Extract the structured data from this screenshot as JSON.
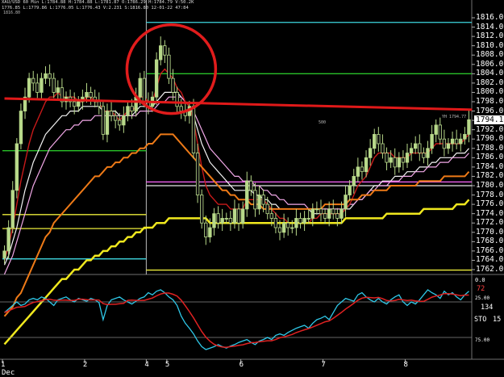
{
  "header": {
    "line1": "XAU/USD 60 Min L:1784.88 H:1784.88 L:1781.87 O:1786.29 H:1784.79 V:50.2K",
    "line2": "1776.85 L:1779.86 L:1776.05 L:1776.43 V:2.231 S:1816.80 12-01-22 47:84"
  },
  "labels": {
    "top_left_price": "1816.80",
    "current_price": "1794.14",
    "current_tag": "YH 1794.77",
    "mid_tag": "500",
    "stoch_upper_val": "72",
    "stoch_ref_high": "25.00",
    "stoch_ref_low": "75.00",
    "stoch_name": "STO",
    "stoch_k": "15",
    "stoch_d": "134",
    "stoch_cut": "0.0"
  },
  "colors": {
    "background": "#000000",
    "candle_up": "#b8d98a",
    "candle_down": "#111111",
    "wick": "#b8d98a",
    "hline_green": "#29c229",
    "hline_yellow": "#ecec3a",
    "hline_cyan": "#3ed8e0",
    "hline_pink": "#ff66ff",
    "hline_white": "#e6e6e6",
    "trendline_red": "#e01919",
    "ma_white": "#f4f4f4",
    "ma_pink": "#f2a8e8",
    "ma_darkred": "#c81a1a",
    "ma_orange": "#ee7a17",
    "ma_yellow": "#f0e81e",
    "stoch_k": "#2fc8e8",
    "stoch_d": "#e02222",
    "circle": "#e11c1c",
    "separator": "#707070"
  },
  "chart_data": {
    "type": "candlestick",
    "title": "",
    "ylim": [
      1760,
      1817
    ],
    "y_ticks": [
      "1816.00",
      "1814.00",
      "1812.00",
      "1810.00",
      "1808.00",
      "1806.00",
      "1804.00",
      "1802.00",
      "1800.00",
      "1798.00",
      "1796.00",
      "1794.00",
      "1792.00",
      "1790.00",
      "1788.00",
      "1786.00",
      "1784.00",
      "1782.00",
      "1780.00",
      "1778.00",
      "1776.00",
      "1774.00",
      "1772.00",
      "1770.00",
      "1768.00",
      "1766.00",
      "1764.00",
      "1762.00"
    ],
    "x_labels": [
      {
        "text": "1",
        "bar": 0
      },
      {
        "text": "2",
        "bar": 20
      },
      {
        "text": "4",
        "bar": 35
      },
      {
        "text": "5",
        "bar": 40
      },
      {
        "text": "6",
        "bar": 58
      },
      {
        "text": "7",
        "bar": 78
      },
      {
        "text": "8",
        "bar": 98
      }
    ],
    "x_sub_label": "Dec",
    "day_separator_bar": 35,
    "closes": [
      1766,
      1771,
      1779,
      1789,
      1796,
      1799,
      1803,
      1802,
      1800,
      1803,
      1804,
      1803,
      1800,
      1801,
      1798,
      1799,
      1798,
      1797,
      1798,
      1799,
      1800,
      1799,
      1798,
      1797,
      1791,
      1796,
      1795,
      1794,
      1793,
      1795,
      1797,
      1796,
      1799,
      1803,
      1798,
      1797,
      1799,
      1807,
      1810,
      1808,
      1803,
      1800,
      1797,
      1796,
      1795,
      1797,
      1787,
      1778,
      1772,
      1769,
      1771,
      1774,
      1772,
      1773,
      1773,
      1772,
      1775,
      1772,
      1775,
      1781,
      1779,
      1775,
      1778,
      1776,
      1774,
      1773,
      1771,
      1770,
      1772,
      1771,
      1771,
      1773,
      1772,
      1773,
      1773,
      1775,
      1775,
      1774,
      1773,
      1775,
      1774,
      1773,
      1775,
      1778,
      1780,
      1782,
      1784,
      1783,
      1786,
      1788,
      1791,
      1789,
      1787,
      1785,
      1786,
      1784,
      1786,
      1785,
      1787,
      1788,
      1789,
      1787,
      1786,
      1788,
      1791,
      1793,
      1790,
      1788,
      1789,
      1790,
      1789,
      1790,
      1791,
      1794.14
    ],
    "horizontal_levels": [
      {
        "price": 1815.0,
        "color": "cyan",
        "from_bar": 35
      },
      {
        "price": 1804.0,
        "color": "green",
        "from_bar": 35
      },
      {
        "price": 1787.5,
        "color": "green",
        "from_bar": 0,
        "to_bar": 35
      },
      {
        "price": 1780.8,
        "color": "pink",
        "from_bar": 35
      },
      {
        "price": 1780.0,
        "color": "white",
        "from_bar": 35
      },
      {
        "price": 1773.8,
        "color": "yellow",
        "from_bar": 0,
        "to_bar": 35
      },
      {
        "price": 1770.8,
        "color": "yellow",
        "from_bar": 0,
        "to_bar": 35
      },
      {
        "price": 1764.3,
        "color": "cyan",
        "from_bar": 0,
        "to_bar": 35
      },
      {
        "price": 1761.9,
        "color": "yellow",
        "from_bar": 35
      }
    ],
    "trendline": {
      "from_bar": 0,
      "from_price": 1798.7,
      "to_bar": 113,
      "to_price": 1796.3
    },
    "moving_averages": [
      {
        "color": "white",
        "values": [
          1763,
          1765,
          1768,
          1771,
          1775,
          1779,
          1782,
          1785,
          1787,
          1789,
          1791,
          1792,
          1793,
          1794,
          1795,
          1795,
          1796,
          1796,
          1796,
          1797,
          1797,
          1797,
          1797,
          1797,
          1796,
          1796,
          1796,
          1796,
          1795,
          1795,
          1795,
          1795,
          1796,
          1797,
          1797,
          1797,
          1797,
          1798,
          1799,
          1800,
          1800,
          1800,
          1800,
          1799,
          1798,
          1797,
          1795,
          1792,
          1789,
          1787,
          1785,
          1784,
          1783,
          1782,
          1781,
          1780,
          1779,
          1779,
          1779,
          1779,
          1779,
          1778,
          1778,
          1777,
          1777,
          1776,
          1776,
          1775,
          1775,
          1775,
          1775,
          1775,
          1775,
          1775,
          1775,
          1774,
          1774,
          1774,
          1774,
          1774,
          1774,
          1774,
          1774,
          1775,
          1775,
          1776,
          1777,
          1777,
          1778,
          1779,
          1780,
          1780,
          1781,
          1781,
          1781,
          1782,
          1782,
          1782,
          1783,
          1783,
          1783,
          1784,
          1784,
          1784,
          1785,
          1785,
          1786,
          1786,
          1786,
          1786,
          1787,
          1787,
          1787,
          1788
        ]
      },
      {
        "color": "pink",
        "values": [
          1761,
          1763,
          1765,
          1768,
          1771,
          1774,
          1777,
          1780,
          1782,
          1784,
          1786,
          1788,
          1789,
          1790,
          1791,
          1792,
          1792,
          1793,
          1793,
          1794,
          1794,
          1794,
          1795,
          1795,
          1795,
          1795,
          1795,
          1795,
          1795,
          1795,
          1795,
          1795,
          1795,
          1796,
          1796,
          1796,
          1796,
          1797,
          1798,
          1798,
          1799,
          1799,
          1799,
          1799,
          1798,
          1797,
          1796,
          1794,
          1792,
          1790,
          1788,
          1787,
          1786,
          1785,
          1784,
          1783,
          1782,
          1782,
          1781,
          1781,
          1781,
          1780,
          1780,
          1779,
          1779,
          1778,
          1778,
          1777,
          1777,
          1776,
          1776,
          1776,
          1776,
          1776,
          1775,
          1775,
          1775,
          1775,
          1775,
          1775,
          1775,
          1775,
          1775,
          1775,
          1776,
          1776,
          1777,
          1777,
          1778,
          1779,
          1779,
          1780,
          1780,
          1780,
          1781,
          1781,
          1781,
          1782,
          1782,
          1782,
          1783,
          1783,
          1783,
          1784,
          1784,
          1784,
          1785,
          1785,
          1785,
          1786,
          1786,
          1786,
          1786,
          1787
        ]
      },
      {
        "color": "darkred",
        "values": [
          1764,
          1767,
          1771,
          1776,
          1781,
          1785,
          1789,
          1792,
          1794,
          1796,
          1798,
          1799,
          1799,
          1800,
          1799,
          1799,
          1799,
          1799,
          1798,
          1798,
          1799,
          1799,
          1798,
          1798,
          1796,
          1796,
          1796,
          1795,
          1794,
          1795,
          1796,
          1796,
          1797,
          1799,
          1799,
          1798,
          1798,
          1801,
          1804,
          1805,
          1804,
          1803,
          1801,
          1800,
          1798,
          1797,
          1794,
          1789,
          1784,
          1780,
          1778,
          1777,
          1776,
          1776,
          1776,
          1775,
          1775,
          1775,
          1775,
          1777,
          1777,
          1777,
          1777,
          1777,
          1776,
          1775,
          1774,
          1773,
          1773,
          1772,
          1772,
          1772,
          1772,
          1772,
          1772,
          1773,
          1773,
          1774,
          1774,
          1774,
          1774,
          1774,
          1774,
          1775,
          1776,
          1778,
          1780,
          1781,
          1782,
          1784,
          1786,
          1787,
          1787,
          1787,
          1787,
          1786,
          1786,
          1786,
          1786,
          1787,
          1787,
          1787,
          1787,
          1787,
          1788,
          1789,
          1789,
          1789,
          1789,
          1789,
          1789,
          1789,
          1790,
          1791
        ]
      },
      {
        "color": "orange",
        "values": [
          1752,
          1753,
          1754,
          1756,
          1757,
          1759,
          1761,
          1763,
          1765,
          1767,
          1769,
          1770,
          1772,
          1773,
          1774,
          1775,
          1776,
          1777,
          1778,
          1779,
          1780,
          1781,
          1782,
          1782,
          1783,
          1784,
          1784,
          1785,
          1785,
          1786,
          1786,
          1787,
          1787,
          1788,
          1788,
          1789,
          1789,
          1790,
          1791,
          1791,
          1791,
          1791,
          1790,
          1789,
          1788,
          1787,
          1786,
          1785,
          1784,
          1783,
          1782,
          1781,
          1780,
          1779,
          1779,
          1778,
          1778,
          1777,
          1777,
          1777,
          1776,
          1776,
          1776,
          1775,
          1775,
          1775,
          1775,
          1775,
          1775,
          1775,
          1775,
          1775,
          1775,
          1775,
          1775,
          1775,
          1775,
          1775,
          1776,
          1776,
          1776,
          1776,
          1776,
          1776,
          1777,
          1777,
          1777,
          1778,
          1778,
          1778,
          1779,
          1779,
          1779,
          1779,
          1780,
          1780,
          1780,
          1780,
          1780,
          1780,
          1780,
          1781,
          1781,
          1781,
          1781,
          1781,
          1781,
          1782,
          1782,
          1782,
          1782,
          1782,
          1782,
          1783
        ]
      },
      {
        "color": "yellow",
        "values": [
          1746,
          1747,
          1748,
          1749,
          1750,
          1751,
          1752,
          1753,
          1754,
          1755,
          1756,
          1757,
          1758,
          1759,
          1760,
          1760,
          1761,
          1762,
          1762,
          1763,
          1764,
          1764,
          1765,
          1765,
          1766,
          1766,
          1767,
          1767,
          1768,
          1768,
          1769,
          1769,
          1770,
          1770,
          1771,
          1771,
          1771,
          1772,
          1772,
          1772,
          1773,
          1773,
          1773,
          1773,
          1773,
          1773,
          1773,
          1773,
          1773,
          1773,
          1772,
          1772,
          1772,
          1772,
          1772,
          1772,
          1772,
          1772,
          1772,
          1772,
          1772,
          1772,
          1772,
          1772,
          1772,
          1772,
          1772,
          1772,
          1772,
          1772,
          1772,
          1772,
          1772,
          1772,
          1772,
          1772,
          1772,
          1772,
          1772,
          1772,
          1772,
          1772,
          1772,
          1773,
          1773,
          1773,
          1773,
          1773,
          1773,
          1773,
          1773,
          1773,
          1773,
          1774,
          1774,
          1774,
          1774,
          1774,
          1774,
          1774,
          1774,
          1774,
          1775,
          1775,
          1775,
          1775,
          1775,
          1775,
          1775,
          1775,
          1776,
          1776,
          1776,
          1777
        ]
      }
    ],
    "highlight_circle": {
      "bar": 40,
      "price": 1805.5
    },
    "stochastic": {
      "ylim": [
        0,
        100
      ],
      "levels": [
        25,
        75
      ],
      "k": [
        40,
        35,
        30,
        25,
        30,
        28,
        22,
        20,
        22,
        18,
        20,
        25,
        30,
        22,
        20,
        18,
        22,
        25,
        20,
        22,
        24,
        20,
        22,
        26,
        50,
        30,
        22,
        20,
        18,
        22,
        25,
        28,
        24,
        20,
        18,
        12,
        15,
        10,
        8,
        12,
        18,
        22,
        30,
        45,
        55,
        62,
        70,
        80,
        88,
        92,
        90,
        88,
        85,
        88,
        90,
        87,
        85,
        82,
        80,
        78,
        82,
        85,
        80,
        78,
        75,
        78,
        72,
        70,
        72,
        68,
        65,
        62,
        60,
        58,
        62,
        55,
        50,
        48,
        45,
        50,
        40,
        30,
        25,
        20,
        22,
        24,
        15,
        12,
        18,
        22,
        25,
        20,
        25,
        28,
        22,
        18,
        15,
        25,
        30,
        25,
        28,
        22,
        15,
        8,
        12,
        15,
        20,
        10,
        15,
        12,
        18,
        22,
        15,
        10
      ]
    }
  }
}
